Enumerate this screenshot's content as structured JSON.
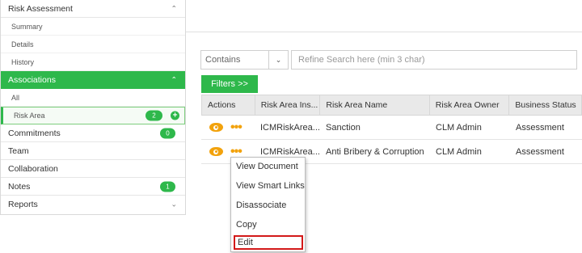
{
  "sidebar": {
    "risk_assessment": {
      "label": "Risk Assessment",
      "items": [
        {
          "label": "Summary"
        },
        {
          "label": "Details"
        },
        {
          "label": "History"
        }
      ]
    },
    "associations": {
      "label": "Associations",
      "items": [
        {
          "label": "All"
        },
        {
          "label": "Risk Area",
          "count": "2"
        }
      ]
    },
    "commitments": {
      "label": "Commitments",
      "count": "0"
    },
    "team": {
      "label": "Team"
    },
    "collaboration": {
      "label": "Collaboration"
    },
    "notes": {
      "label": "Notes",
      "count": "1"
    },
    "reports": {
      "label": "Reports"
    }
  },
  "search": {
    "operator": "Contains",
    "placeholder": "Refine Search here (min 3 char)",
    "value": ""
  },
  "filters": {
    "label": "Filters >>"
  },
  "table": {
    "columns": [
      "Actions",
      "Risk Area Ins...",
      "Risk Area Name",
      "Risk Area Owner",
      "Business Status"
    ],
    "rows": [
      {
        "instance": "ICMRiskArea...",
        "name": "Sanction",
        "owner": "CLM Admin",
        "status": "Assessment"
      },
      {
        "instance": "ICMRiskArea...",
        "name": "Anti Bribery & Corruption",
        "owner": "CLM Admin",
        "status": "Assessment"
      }
    ]
  },
  "context_menu": {
    "items": [
      "View Document",
      "View Smart Links",
      "Disassociate",
      "Copy",
      "Edit"
    ]
  },
  "colors": {
    "accent": "#2eb84b",
    "icon": "#f2a20c",
    "highlight": "#d31919"
  },
  "icons": {
    "expand": "chevron-up-icon",
    "collapse": "chevron-down-icon",
    "add": "plus-circle-icon",
    "view": "eye-icon",
    "more": "more-dots-icon"
  }
}
